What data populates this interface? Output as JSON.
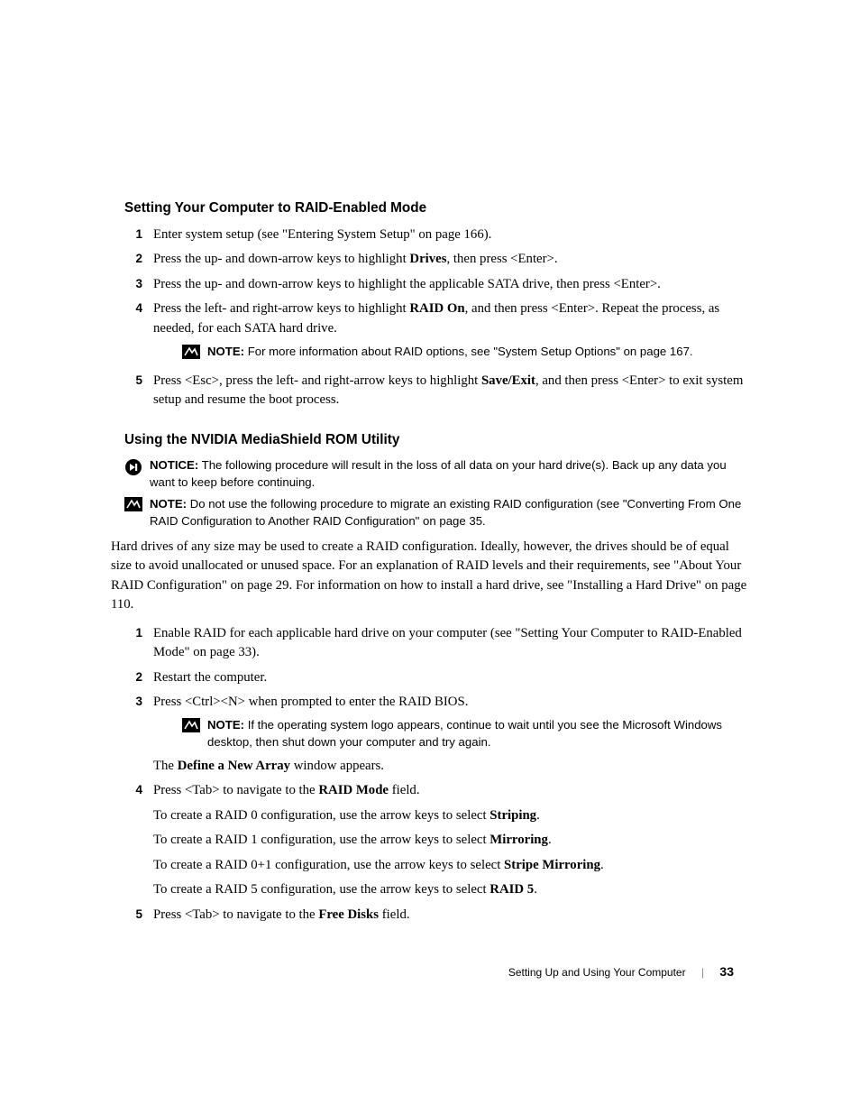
{
  "section1": {
    "heading": "Setting Your Computer to RAID-Enabled Mode",
    "steps": [
      {
        "n": "1",
        "runs": [
          {
            "t": "Enter system setup (see \"Entering System Setup\" on page 166)."
          }
        ]
      },
      {
        "n": "2",
        "runs": [
          {
            "t": "Press the up- and down-arrow keys to highlight "
          },
          {
            "t": "Drives",
            "b": true
          },
          {
            "t": ", then press <Enter>."
          }
        ]
      },
      {
        "n": "3",
        "runs": [
          {
            "t": "Press the up- and down-arrow keys to highlight the applicable SATA drive, then press <Enter>."
          }
        ]
      },
      {
        "n": "4",
        "runs": [
          {
            "t": "Press the left- and right-arrow keys to highlight "
          },
          {
            "t": "RAID On",
            "b": true
          },
          {
            "t": ", and then press <Enter>. Repeat the process, as needed, for each SATA hard drive."
          }
        ],
        "note": {
          "lead": "NOTE:",
          "text": " For more information about RAID options, see \"System Setup Options\" on page 167."
        }
      },
      {
        "n": "5",
        "runs": [
          {
            "t": "Press <Esc>, press the left- and right-arrow keys to highlight "
          },
          {
            "t": "Save/Exit",
            "b": true
          },
          {
            "t": ", and then press <Enter> to exit system setup and resume the boot process."
          }
        ]
      }
    ]
  },
  "section2": {
    "heading": "Using the NVIDIA MediaShield ROM Utility",
    "notice": {
      "lead": "NOTICE:",
      "text": " The following procedure will result in the loss of all data on your hard drive(s). Back up any data you want to keep before continuing."
    },
    "note": {
      "lead": "NOTE:",
      "text": " Do not use the following procedure to migrate an existing RAID configuration (see \"Converting From One RAID Configuration to Another RAID Configuration\" on page 35."
    },
    "para": "Hard drives of any size may be used to create a RAID configuration. Ideally, however, the drives should be of equal size to avoid unallocated or unused space. For an explanation of RAID levels and their requirements, see \"About Your RAID Configuration\" on page 29. For information on how to install a hard drive, see \"Installing a Hard Drive\" on page 110.",
    "steps": [
      {
        "n": "1",
        "runs": [
          {
            "t": "Enable RAID for each applicable hard drive on your computer (see \"Setting Your Computer to RAID-Enabled Mode\" on page 33)."
          }
        ]
      },
      {
        "n": "2",
        "runs": [
          {
            "t": "Restart the computer."
          }
        ]
      },
      {
        "n": "3",
        "runs": [
          {
            "t": "Press <Ctrl><N> when prompted to enter the RAID BIOS."
          }
        ],
        "note": {
          "lead": "NOTE:",
          "text": " If the operating system logo appears, continue to wait until you see the Microsoft Windows desktop, then shut down your computer and try again."
        },
        "after": [
          [
            {
              "t": "The "
            },
            {
              "t": "Define a New Array",
              "b": true
            },
            {
              "t": " window appears."
            }
          ]
        ]
      },
      {
        "n": "4",
        "runs": [
          {
            "t": "Press <Tab> to navigate to the "
          },
          {
            "t": "RAID Mode",
            "b": true
          },
          {
            "t": " field."
          }
        ],
        "after": [
          [
            {
              "t": "To create a RAID 0 configuration, use the arrow keys to select "
            },
            {
              "t": "Striping",
              "b": true
            },
            {
              "t": "."
            }
          ],
          [
            {
              "t": "To create a RAID 1 configuration, use the arrow keys to select "
            },
            {
              "t": "Mirroring",
              "b": true
            },
            {
              "t": "."
            }
          ],
          [
            {
              "t": "To create a RAID 0+1 configuration, use the arrow keys to select "
            },
            {
              "t": "Stripe Mirroring",
              "b": true
            },
            {
              "t": "."
            }
          ],
          [
            {
              "t": "To create a RAID 5 configuration, use the arrow keys to select "
            },
            {
              "t": "RAID 5",
              "b": true
            },
            {
              "t": "."
            }
          ]
        ]
      },
      {
        "n": "5",
        "runs": [
          {
            "t": "Press <Tab> to navigate to the "
          },
          {
            "t": "Free Disks",
            "b": true
          },
          {
            "t": " field."
          }
        ]
      }
    ]
  },
  "footer": {
    "title": "Setting Up and Using Your Computer",
    "page": "33"
  }
}
